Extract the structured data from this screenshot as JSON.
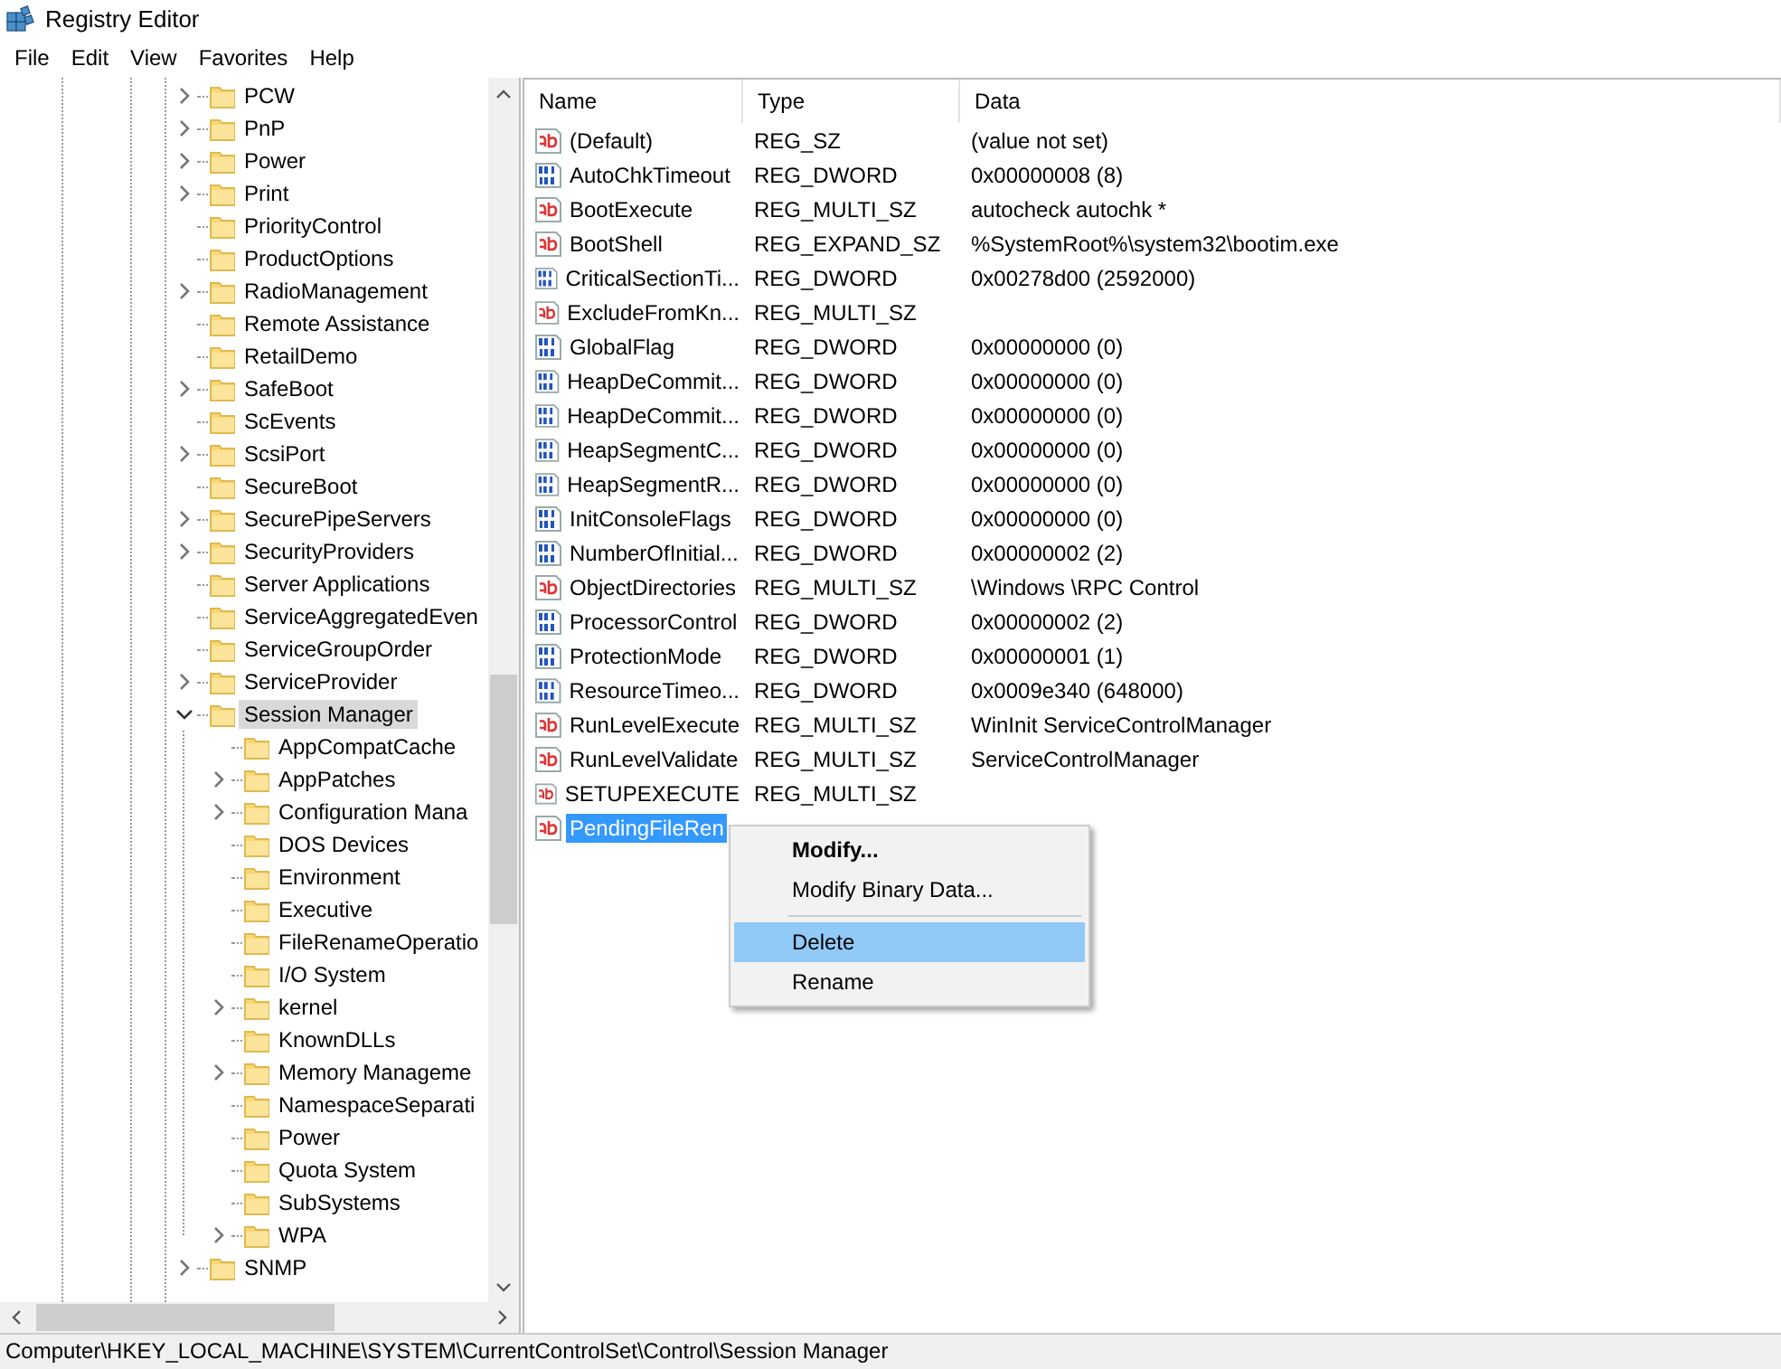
{
  "window": {
    "title": "Registry Editor"
  },
  "menu_bar": [
    "File",
    "Edit",
    "View",
    "Favorites",
    "Help"
  ],
  "tree": {
    "items": [
      {
        "label": "PCW",
        "expandable": true,
        "expanded": false,
        "selected": false
      },
      {
        "label": "PnP",
        "expandable": true,
        "expanded": false,
        "selected": false
      },
      {
        "label": "Power",
        "expandable": true,
        "expanded": false,
        "selected": false
      },
      {
        "label": "Print",
        "expandable": true,
        "expanded": false,
        "selected": false
      },
      {
        "label": "PriorityControl",
        "expandable": false,
        "selected": false
      },
      {
        "label": "ProductOptions",
        "expandable": false,
        "selected": false
      },
      {
        "label": "RadioManagement",
        "expandable": true,
        "expanded": false,
        "selected": false
      },
      {
        "label": "Remote Assistance",
        "expandable": false,
        "selected": false
      },
      {
        "label": "RetailDemo",
        "expandable": false,
        "selected": false
      },
      {
        "label": "SafeBoot",
        "expandable": true,
        "expanded": false,
        "selected": false
      },
      {
        "label": "ScEvents",
        "expandable": false,
        "selected": false
      },
      {
        "label": "ScsiPort",
        "expandable": true,
        "expanded": false,
        "selected": false
      },
      {
        "label": "SecureBoot",
        "expandable": false,
        "selected": false
      },
      {
        "label": "SecurePipeServers",
        "expandable": true,
        "expanded": false,
        "selected": false
      },
      {
        "label": "SecurityProviders",
        "expandable": true,
        "expanded": false,
        "selected": false
      },
      {
        "label": "Server Applications",
        "expandable": false,
        "selected": false
      },
      {
        "label": "ServiceAggregatedEven",
        "expandable": false,
        "selected": false
      },
      {
        "label": "ServiceGroupOrder",
        "expandable": false,
        "selected": false
      },
      {
        "label": "ServiceProvider",
        "expandable": true,
        "expanded": false,
        "selected": false
      },
      {
        "label": "Session Manager",
        "expandable": true,
        "expanded": true,
        "selected": true,
        "children": [
          {
            "label": "AppCompatCache",
            "expandable": false,
            "selected": false
          },
          {
            "label": "AppPatches",
            "expandable": true,
            "expanded": false,
            "selected": false
          },
          {
            "label": "Configuration Mana",
            "expandable": true,
            "expanded": false,
            "selected": false
          },
          {
            "label": "DOS Devices",
            "expandable": false,
            "selected": false
          },
          {
            "label": "Environment",
            "expandable": false,
            "selected": false
          },
          {
            "label": "Executive",
            "expandable": false,
            "selected": false
          },
          {
            "label": "FileRenameOperatio",
            "expandable": false,
            "selected": false
          },
          {
            "label": "I/O System",
            "expandable": false,
            "selected": false
          },
          {
            "label": "kernel",
            "expandable": true,
            "expanded": false,
            "selected": false
          },
          {
            "label": "KnownDLLs",
            "expandable": false,
            "selected": false
          },
          {
            "label": "Memory Manageme",
            "expandable": true,
            "expanded": false,
            "selected": false
          },
          {
            "label": "NamespaceSeparati",
            "expandable": false,
            "selected": false
          },
          {
            "label": "Power",
            "expandable": false,
            "selected": false
          },
          {
            "label": "Quota System",
            "expandable": false,
            "selected": false
          },
          {
            "label": "SubSystems",
            "expandable": false,
            "selected": false
          },
          {
            "label": "WPA",
            "expandable": true,
            "expanded": false,
            "selected": false
          }
        ]
      },
      {
        "label": "SNMP",
        "expandable": true,
        "expanded": false,
        "selected": false
      }
    ]
  },
  "values": {
    "columns": [
      "Name",
      "Type",
      "Data"
    ],
    "rows": [
      {
        "kind": "string",
        "name": "(Default)",
        "type": "REG_SZ",
        "data": "(value not set)",
        "selected": false
      },
      {
        "kind": "binary",
        "name": "AutoChkTimeout",
        "type": "REG_DWORD",
        "data": "0x00000008 (8)",
        "selected": false
      },
      {
        "kind": "string",
        "name": "BootExecute",
        "type": "REG_MULTI_SZ",
        "data": "autocheck autochk *",
        "selected": false
      },
      {
        "kind": "string",
        "name": "BootShell",
        "type": "REG_EXPAND_SZ",
        "data": "%SystemRoot%\\system32\\bootim.exe",
        "selected": false
      },
      {
        "kind": "binary",
        "name": "CriticalSectionTi...",
        "type": "REG_DWORD",
        "data": "0x00278d00 (2592000)",
        "selected": false
      },
      {
        "kind": "string",
        "name": "ExcludeFromKn...",
        "type": "REG_MULTI_SZ",
        "selected": false
      },
      {
        "kind": "binary",
        "name": "GlobalFlag",
        "type": "REG_DWORD",
        "data": "0x00000000 (0)",
        "selected": false
      },
      {
        "kind": "binary",
        "name": "HeapDeCommit...",
        "type": "REG_DWORD",
        "data": "0x00000000 (0)",
        "selected": false
      },
      {
        "kind": "binary",
        "name": "HeapDeCommit...",
        "type": "REG_DWORD",
        "data": "0x00000000 (0)",
        "selected": false
      },
      {
        "kind": "binary",
        "name": "HeapSegmentC...",
        "type": "REG_DWORD",
        "data": "0x00000000 (0)",
        "selected": false
      },
      {
        "kind": "binary",
        "name": "HeapSegmentR...",
        "type": "REG_DWORD",
        "data": "0x00000000 (0)",
        "selected": false
      },
      {
        "kind": "binary",
        "name": "InitConsoleFlags",
        "type": "REG_DWORD",
        "data": "0x00000000 (0)",
        "selected": false
      },
      {
        "kind": "binary",
        "name": "NumberOfInitial...",
        "type": "REG_DWORD",
        "data": "0x00000002 (2)",
        "selected": false
      },
      {
        "kind": "string",
        "name": "ObjectDirectories",
        "type": "REG_MULTI_SZ",
        "data": "\\Windows \\RPC Control",
        "selected": false
      },
      {
        "kind": "binary",
        "name": "ProcessorControl",
        "type": "REG_DWORD",
        "data": "0x00000002 (2)",
        "selected": false
      },
      {
        "kind": "binary",
        "name": "ProtectionMode",
        "type": "REG_DWORD",
        "data": "0x00000001 (1)",
        "selected": false
      },
      {
        "kind": "binary",
        "name": "ResourceTimeo...",
        "type": "REG_DWORD",
        "data": "0x0009e340 (648000)",
        "selected": false
      },
      {
        "kind": "string",
        "name": "RunLevelExecute",
        "type": "REG_MULTI_SZ",
        "data": "WinInit ServiceControlManager",
        "selected": false
      },
      {
        "kind": "string",
        "name": "RunLevelValidate",
        "type": "REG_MULTI_SZ",
        "data": "ServiceControlManager",
        "selected": false
      },
      {
        "kind": "string",
        "name": "SETUPEXECUTE",
        "type": "REG_MULTI_SZ",
        "selected": false
      },
      {
        "kind": "string",
        "name": "PendingFileRen",
        "selected": true
      }
    ]
  },
  "context_menu": {
    "items": [
      {
        "kind": "item",
        "label": "Modify...",
        "default": true,
        "selected": false
      },
      {
        "kind": "item",
        "label": "Modify Binary Data...",
        "default": false,
        "selected": false
      },
      {
        "kind": "separator"
      },
      {
        "kind": "item",
        "label": "Delete",
        "default": false,
        "selected": true
      },
      {
        "kind": "item",
        "label": "Rename",
        "default": false,
        "selected": false
      }
    ]
  },
  "status_bar": "Computer\\HKEY_LOCAL_MACHINE\\SYSTEM\\CurrentControlSet\\Control\\Session Manager"
}
